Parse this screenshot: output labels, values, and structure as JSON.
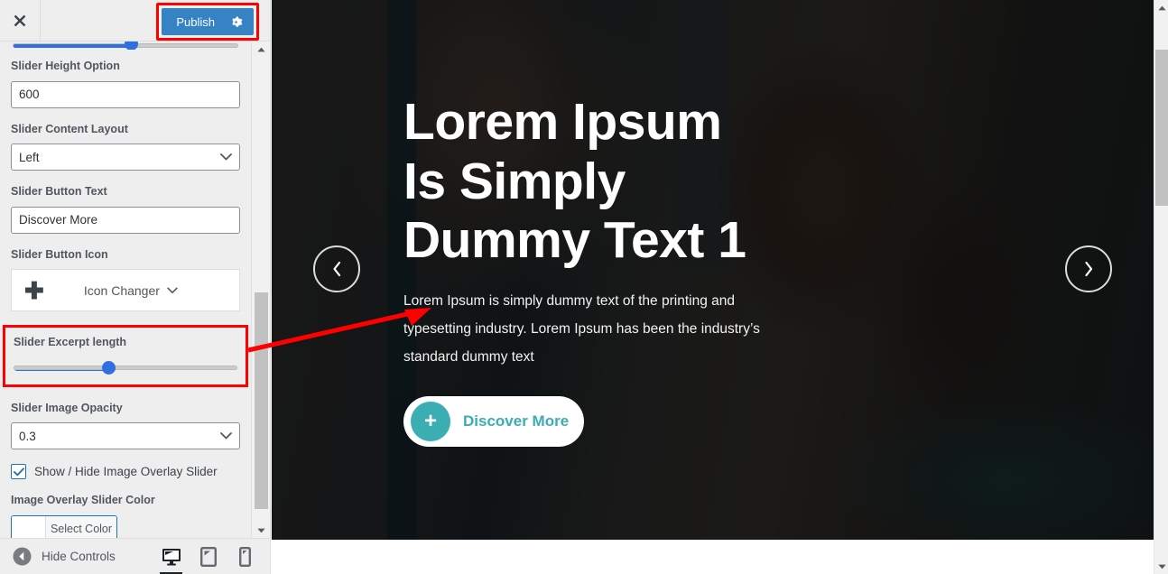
{
  "customizer": {
    "header": {
      "close_label": "×",
      "publish_label": "Publish",
      "gear_icon": "gear-icon",
      "publish_color": "#3582c4",
      "highlight_color": "#ff0000"
    },
    "controls": [
      {
        "label": "Slider Height Option",
        "type": "text",
        "value": "600"
      },
      {
        "label": "Slider Content Layout",
        "type": "select",
        "value": "Left"
      },
      {
        "label": "Slider Button Text",
        "type": "text",
        "value": "Discover More"
      },
      {
        "label": "Slider Button Icon",
        "type": "icon-picker",
        "value": "Icon Changer"
      },
      {
        "label": "Slider Excerpt length",
        "type": "range",
        "value": 42,
        "highlighted": true
      },
      {
        "label": "Slider Image Opacity",
        "type": "select",
        "value": "0.3"
      },
      {
        "label": "Show / Hide Image Overlay Slider",
        "type": "checkbox",
        "checked": true
      },
      {
        "label": "Image Overlay Slider Color",
        "type": "color",
        "value": "Select Color"
      }
    ],
    "footer": {
      "hide_controls_label": "Hide Controls",
      "devices": [
        {
          "name": "desktop",
          "active": true
        },
        {
          "name": "tablet",
          "active": false
        },
        {
          "name": "mobile",
          "active": false
        }
      ]
    }
  },
  "preview": {
    "slide": {
      "title": "Lorem Ipsum Is Simply Dummy Text 1",
      "excerpt": "Lorem Ipsum is simply dummy text of the printing and typesetting industry. Lorem Ipsum has been the industry’s standard dummy text",
      "button_label": "Discover More",
      "button_icon": "plus-icon",
      "accent_color": "#3aaeb2",
      "prev_label": "‹",
      "next_label": "›"
    }
  }
}
